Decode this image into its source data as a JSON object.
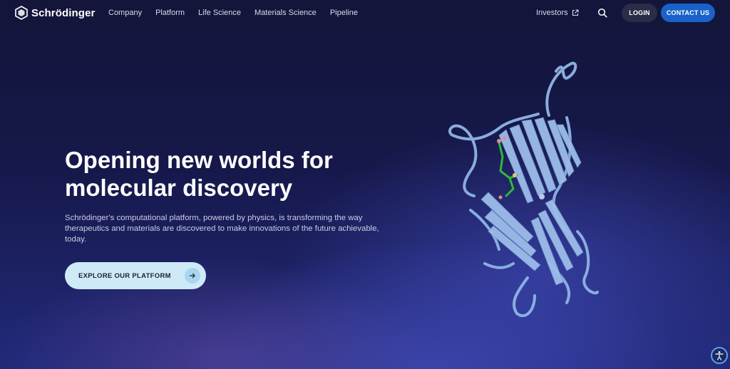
{
  "brand": {
    "name": "Schrödinger"
  },
  "nav": {
    "items": [
      "Company",
      "Platform",
      "Life Science",
      "Materials Science",
      "Pipeline"
    ],
    "investors": "Investors",
    "login": "LOGIN",
    "contact": "CONTACT US"
  },
  "hero": {
    "title_line1": "Opening new worlds for",
    "title_line2": "molecular discovery",
    "description": "Schrödinger's computational platform, powered by physics, is transforming the way therapeutics and materials are discovered to make innovations of the future achievable, today.",
    "cta": "EXPLORE OUR PLATFORM"
  },
  "colors": {
    "primary": "#1862c9",
    "cta_bg": "#cfeaf7",
    "login_bg": "#2a2d45"
  },
  "icons": {
    "search": "search-icon",
    "external": "external-link-icon",
    "arrow": "arrow-right-icon",
    "accessibility": "accessibility-icon"
  }
}
